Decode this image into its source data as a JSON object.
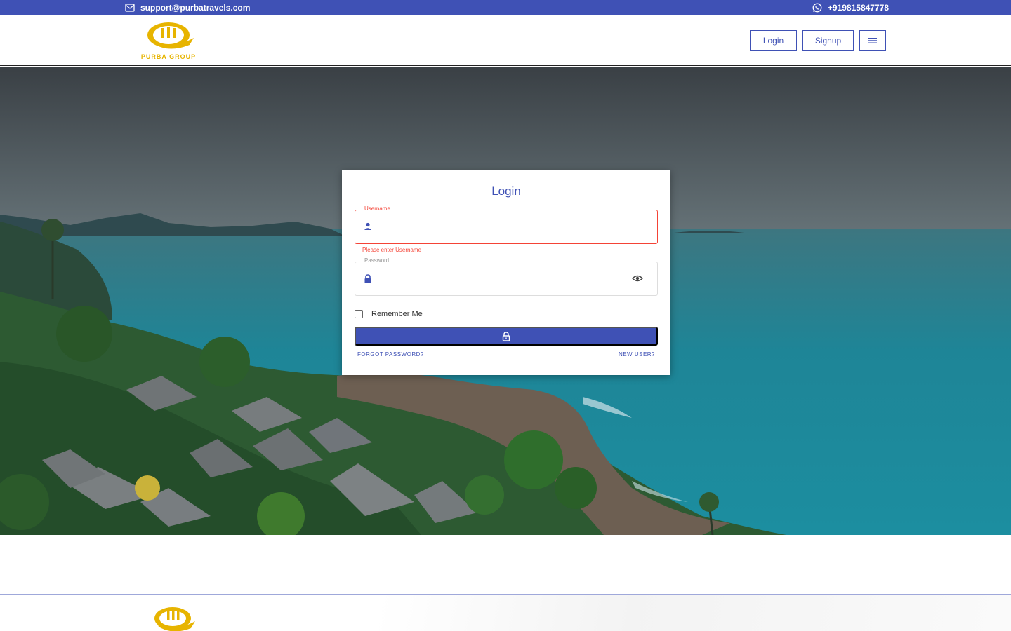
{
  "topbar": {
    "email": "support@purbatravels.com",
    "phone": "+919815847778",
    "email_icon": "mail-icon",
    "phone_icon": "whatsapp-icon"
  },
  "header": {
    "logo_text": "PURBA GROUP",
    "nav": {
      "login_label": "Login",
      "signup_label": "Signup",
      "menu_icon": "menu-icon"
    }
  },
  "login_form": {
    "title": "Login",
    "username": {
      "label": "Username",
      "value": "",
      "error": "Please enter Username",
      "icon": "person-icon"
    },
    "password": {
      "label": "Password",
      "value": "",
      "icon": "lock-icon",
      "toggle_icon": "eye-icon"
    },
    "remember_label": "Remember Me",
    "remember_checked": false,
    "submit_icon": "unlock-icon",
    "forgot_label": "FORGOT PASSWORD?",
    "new_user_label": "NEW USER?"
  },
  "colors": {
    "primary": "#3f51b5",
    "error": "#f44336",
    "logo_gold": "#e7b400"
  }
}
